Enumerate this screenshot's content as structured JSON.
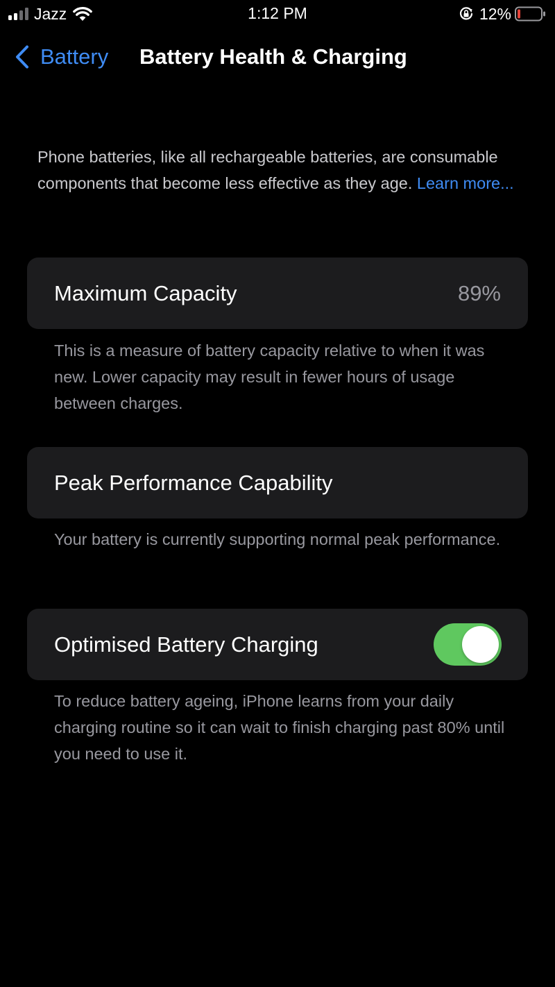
{
  "status_bar": {
    "carrier": "Jazz",
    "time": "1:12 PM",
    "battery_percent": "12%",
    "signal_bars_filled": 2,
    "signal_bars_total": 4,
    "battery_level": 0.12,
    "battery_color": "#e5443a",
    "icons": [
      "signal-icon",
      "wifi-icon",
      "orientation-lock-icon",
      "battery-icon"
    ]
  },
  "nav": {
    "back_label": "Battery",
    "title": "Battery Health & Charging"
  },
  "intro": {
    "text": "Phone batteries, like all rechargeable batteries, are consumable components that become less effective as they age.",
    "link": "Learn more..."
  },
  "maximum_capacity": {
    "label": "Maximum Capacity",
    "value": "89%",
    "footer": "This is a measure of battery capacity relative to when it was new. Lower capacity may result in fewer hours of usage between charges."
  },
  "peak_performance": {
    "label": "Peak Performance Capability",
    "footer": "Your battery is currently supporting normal peak performance."
  },
  "optimised_charging": {
    "label": "Optimised Battery Charging",
    "enabled": true,
    "toggle_color": "#5fc85f",
    "footer": "To reduce battery ageing, iPhone learns from your daily charging routine so it can wait to finish charging past 80% until you need to use it."
  },
  "colors": {
    "accent": "#3f8cf4",
    "background": "#000000",
    "card": "#1c1c1e",
    "secondary_text": "#98989f"
  }
}
